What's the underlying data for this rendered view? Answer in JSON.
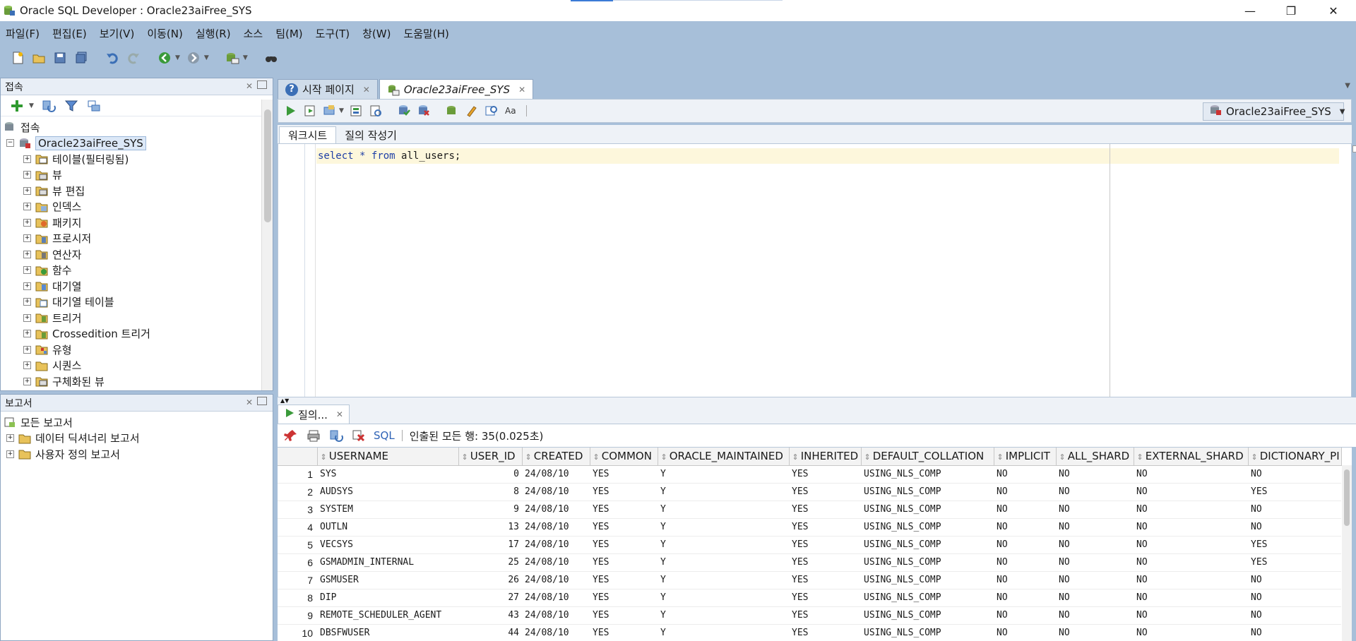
{
  "window": {
    "title": "Oracle SQL Developer : Oracle23aiFree_SYS",
    "min": "—",
    "max": "❐",
    "close": "✕"
  },
  "menu": [
    "파일(F)",
    "편집(E)",
    "보기(V)",
    "이동(N)",
    "실행(R)",
    "소스",
    "팀(M)",
    "도구(T)",
    "창(W)",
    "도움말(H)"
  ],
  "connections_panel": {
    "title": "접속",
    "root": "접속",
    "connection": "Oracle23aiFree_SYS",
    "items": [
      "테이블(필터링됨)",
      "뷰",
      "뷰 편집",
      "인덱스",
      "패키지",
      "프로시저",
      "연산자",
      "함수",
      "대기열",
      "대기열 테이블",
      "트리거",
      "Crossedition 트리거",
      "유형",
      "시퀀스",
      "구체화된 뷰"
    ]
  },
  "reports_panel": {
    "title": "보고서",
    "root": "모든 보고서",
    "items": [
      "데이터 딕셔너리 보고서",
      "사용자 정의 보고서"
    ]
  },
  "editor_tabs": [
    {
      "label": "시작 페이지",
      "active": false
    },
    {
      "label": "Oracle23aiFree_SYS",
      "active": true
    }
  ],
  "connection_selector": "Oracle23aiFree_SYS",
  "sub_tabs": [
    "워크시트",
    "질의 작성기"
  ],
  "editor": {
    "kw_select": "select",
    "op_star": "*",
    "kw_from": "from",
    "rest": "all_users;"
  },
  "results": {
    "tab_label": "질의...",
    "sql_label": "SQL",
    "status": "인출된 모든 행: 35(0.025초)",
    "columns": [
      "USERNAME",
      "USER_ID",
      "CREATED",
      "COMMON",
      "ORACLE_MAINTAINED",
      "INHERITED",
      "DEFAULT_COLLATION",
      "IMPLICIT",
      "ALL_SHARD",
      "EXTERNAL_SHARD",
      "DICTIONARY_PI"
    ],
    "rows": [
      [
        "1",
        "SYS",
        "0",
        "24/08/10",
        "YES",
        "Y",
        "YES",
        "USING_NLS_COMP",
        "NO",
        "NO",
        "NO",
        "NO"
      ],
      [
        "2",
        "AUDSYS",
        "8",
        "24/08/10",
        "YES",
        "Y",
        "YES",
        "USING_NLS_COMP",
        "NO",
        "NO",
        "NO",
        "YES"
      ],
      [
        "3",
        "SYSTEM",
        "9",
        "24/08/10",
        "YES",
        "Y",
        "YES",
        "USING_NLS_COMP",
        "NO",
        "NO",
        "NO",
        "NO"
      ],
      [
        "4",
        "OUTLN",
        "13",
        "24/08/10",
        "YES",
        "Y",
        "YES",
        "USING_NLS_COMP",
        "NO",
        "NO",
        "NO",
        "NO"
      ],
      [
        "5",
        "VECSYS",
        "17",
        "24/08/10",
        "YES",
        "Y",
        "YES",
        "USING_NLS_COMP",
        "NO",
        "NO",
        "NO",
        "YES"
      ],
      [
        "6",
        "GSMADMIN_INTERNAL",
        "25",
        "24/08/10",
        "YES",
        "Y",
        "YES",
        "USING_NLS_COMP",
        "NO",
        "NO",
        "NO",
        "YES"
      ],
      [
        "7",
        "GSMUSER",
        "26",
        "24/08/10",
        "YES",
        "Y",
        "YES",
        "USING_NLS_COMP",
        "NO",
        "NO",
        "NO",
        "NO"
      ],
      [
        "8",
        "DIP",
        "27",
        "24/08/10",
        "YES",
        "Y",
        "YES",
        "USING_NLS_COMP",
        "NO",
        "NO",
        "NO",
        "NO"
      ],
      [
        "9",
        "REMOTE_SCHEDULER_AGENT",
        "43",
        "24/08/10",
        "YES",
        "Y",
        "YES",
        "USING_NLS_COMP",
        "NO",
        "NO",
        "NO",
        "NO"
      ],
      [
        "10",
        "DBSFWUSER",
        "44",
        "24/08/10",
        "YES",
        "Y",
        "YES",
        "USING_NLS_COMP",
        "NO",
        "NO",
        "NO",
        "NO"
      ]
    ]
  }
}
